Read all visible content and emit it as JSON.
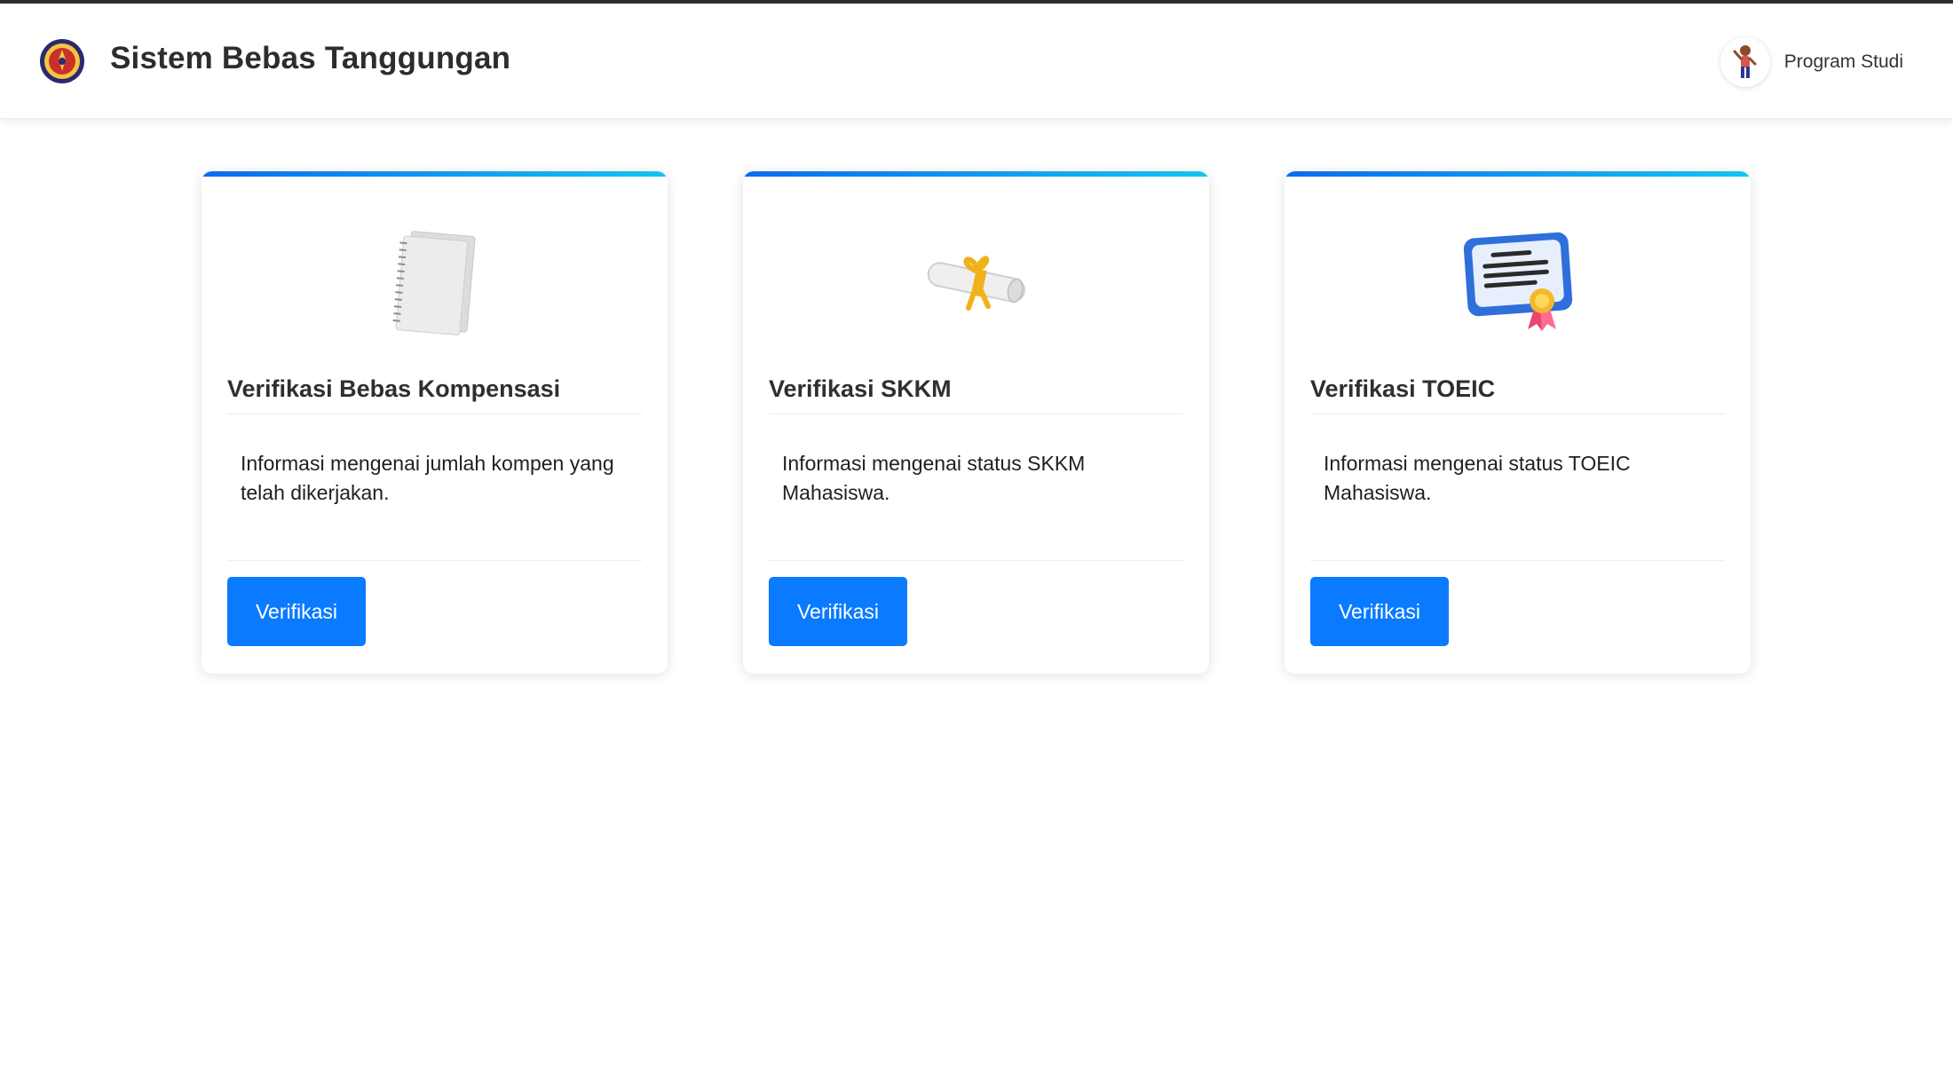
{
  "header": {
    "title": "Sistem Bebas Tanggungan",
    "user_label": "Program Studi"
  },
  "cards": [
    {
      "icon": "notebook-icon",
      "title": "Verifikasi Bebas Kompensasi",
      "description": "Informasi mengenai jumlah kompen yang telah dikerjakan.",
      "button_label": "Verifikasi"
    },
    {
      "icon": "diploma-scroll-icon",
      "title": "Verifikasi SKKM",
      "description": "Informasi mengenai status SKKM Mahasiswa.",
      "button_label": "Verifikasi"
    },
    {
      "icon": "certificate-icon",
      "title": "Verifikasi TOEIC",
      "description": "Informasi mengenai status TOEIC Mahasiswa.",
      "button_label": "Verifikasi"
    }
  ],
  "colors": {
    "accent": "#0a7bff",
    "card_bar_start": "#0a6cf0",
    "card_bar_end": "#14c4f2"
  }
}
